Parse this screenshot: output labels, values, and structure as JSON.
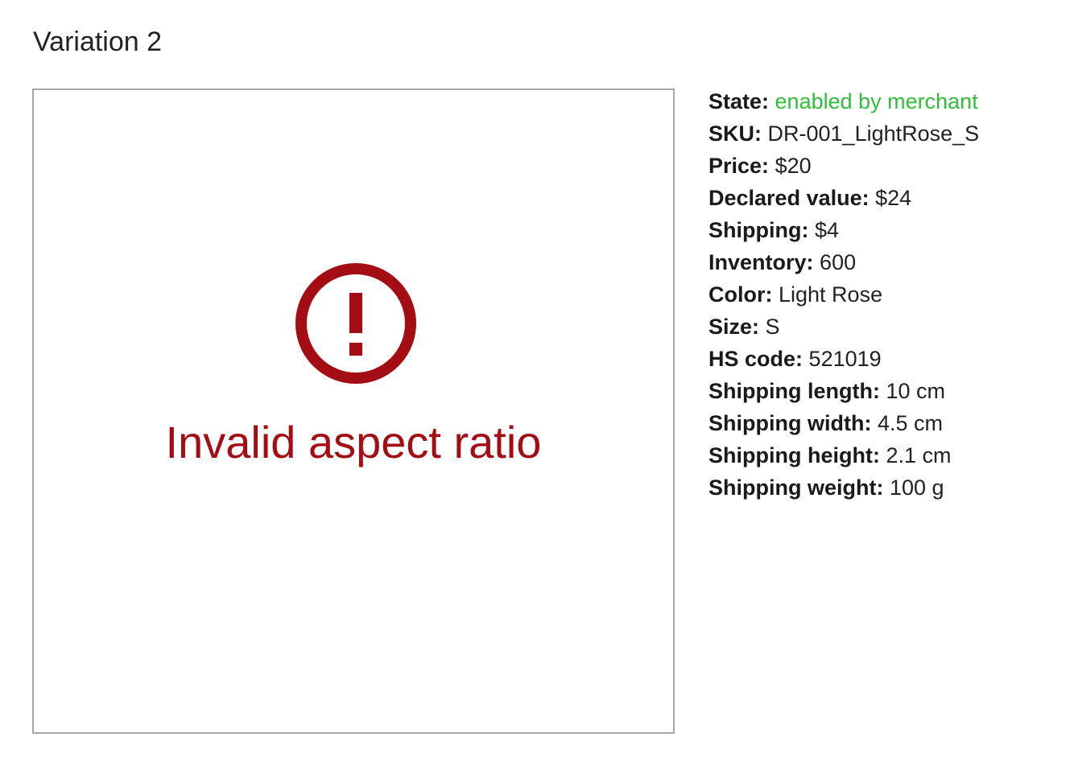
{
  "title": "Variation 2",
  "image_panel": {
    "icon": "error-circle-exclamation-icon",
    "error_message": "Invalid aspect ratio",
    "error_color": "#a50d14"
  },
  "details": [
    {
      "label": "State:",
      "value": "enabled by merchant",
      "value_color": "#2fbf3a"
    },
    {
      "label": "SKU:",
      "value": "DR-001_LightRose_S"
    },
    {
      "label": "Price:",
      "value": "$20"
    },
    {
      "label": "Declared value:",
      "value": "$24"
    },
    {
      "label": "Shipping:",
      "value": "$4"
    },
    {
      "label": "Inventory:",
      "value": "600"
    },
    {
      "label": "Color:",
      "value": "Light Rose"
    },
    {
      "label": "Size:",
      "value": "S"
    },
    {
      "label": "HS code:",
      "value": "521019"
    },
    {
      "label": "Shipping length:",
      "value": "10 cm"
    },
    {
      "label": "Shipping width:",
      "value": "4.5 cm"
    },
    {
      "label": "Shipping height:",
      "value": "2.1 cm"
    },
    {
      "label": "Shipping weight:",
      "value": "100 g"
    }
  ]
}
